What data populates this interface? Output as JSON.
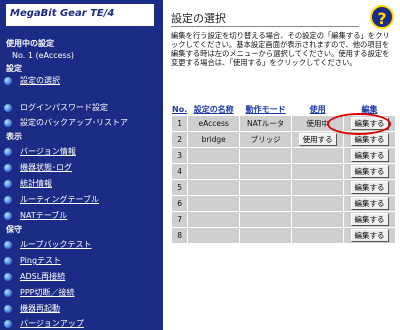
{
  "app": {
    "product_name": "MegaBit Gear TE/4"
  },
  "sidebar": {
    "current_setting_heading": "使用中の設定",
    "current_setting_value": "No. 1 (eAccess)",
    "settings_heading": "設定",
    "settings_items": [
      "設定の選択",
      "ログインパスワード設定",
      "設定のバックアップ･リストア"
    ],
    "display_heading": "表示",
    "display_items": [
      "バージョン情報",
      "機器状態･ログ",
      "統計情報",
      "ルーティングテーブル",
      "NATテーブル"
    ],
    "maintenance_heading": "保守",
    "maintenance_items": [
      "ループバックテスト",
      "Pingテスト",
      "ADSL再接続",
      "PPP切断／接続",
      "機器再起動",
      "バージョンアップ"
    ]
  },
  "main": {
    "title": "設定の選択",
    "help_icon": "?",
    "description": "編集を行う設定を切り替える場合、その設定の「編集する」をクリックしてください。基本設定画面が表示されますので、他の項目を編集する時は左のメニューから選択してください。使用する設定を変更する場合は、「使用する」をクリックしてください。"
  },
  "table": {
    "headers": {
      "no": "No.",
      "name": "設定の名称",
      "mode": "動作モード",
      "use": "使用",
      "edit": "編集"
    },
    "rows": [
      {
        "no": "1",
        "name": "eAccess",
        "mode": "NATルータ",
        "use": "使用中",
        "edit": "編集する"
      },
      {
        "no": "2",
        "name": "bridge",
        "mode": "ブリッジ",
        "use": "使用する",
        "edit": "編集する"
      },
      {
        "no": "3",
        "name": "",
        "mode": "",
        "use": "",
        "edit": "編集する"
      },
      {
        "no": "4",
        "name": "",
        "mode": "",
        "use": "",
        "edit": "編集する"
      },
      {
        "no": "5",
        "name": "",
        "mode": "",
        "use": "",
        "edit": "編集する"
      },
      {
        "no": "6",
        "name": "",
        "mode": "",
        "use": "",
        "edit": "編集する"
      },
      {
        "no": "7",
        "name": "",
        "mode": "",
        "use": "",
        "edit": "編集する"
      },
      {
        "no": "8",
        "name": "",
        "mode": "",
        "use": "",
        "edit": "編集する"
      }
    ]
  },
  "colors": {
    "sidebar_bg": "#1c2c86",
    "header_link": "#1a37a8",
    "cell_bg": "#cfcfcf",
    "highlight_ring": "#e00000"
  }
}
